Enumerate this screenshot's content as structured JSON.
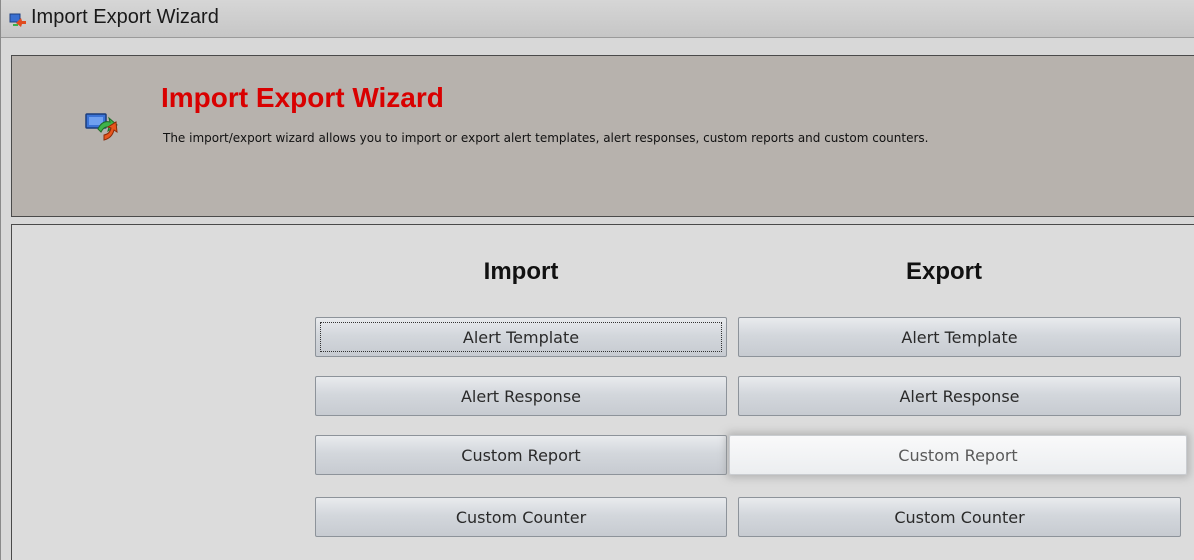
{
  "window": {
    "title": "Import Export Wizard"
  },
  "header": {
    "title": "Import Export Wizard",
    "description": "The import/export wizard allows you to import or export alert templates, alert responses, custom reports and custom counters."
  },
  "import": {
    "heading": "Import",
    "buttons": [
      "Alert Template",
      "Alert Response",
      "Custom Report",
      "Custom Counter"
    ]
  },
  "export": {
    "heading": "Export",
    "buttons": [
      "Alert Template",
      "Alert Response",
      "Custom Report",
      "Custom Counter"
    ]
  },
  "colors": {
    "title_red": "#d90000",
    "header_bg": "#b7b2ad"
  },
  "icons": {
    "app": "wizard-arrows-icon"
  }
}
